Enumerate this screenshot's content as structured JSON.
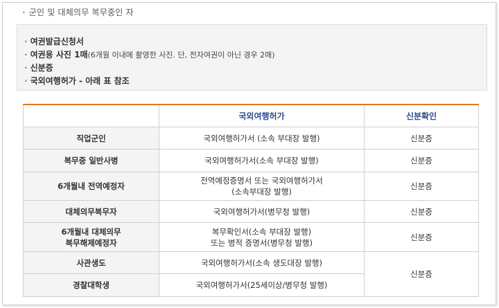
{
  "section_title": "군인 및 대체의무 복무중인 자",
  "documents": [
    {
      "label": "여권발급신청서",
      "note": ""
    },
    {
      "label": "여권용 사진 1매",
      "note": "(6개월 이내에 촬영한 사진. 단, 전자여권이 아닌 경우 2매)"
    },
    {
      "label": "신분증",
      "note": ""
    },
    {
      "label": "국외여행허가 - 아래 표 참조",
      "note": ""
    }
  ],
  "table": {
    "headers": [
      "",
      "국외여행허가",
      "신분확인"
    ],
    "rows": [
      {
        "category": [
          "직업군인"
        ],
        "permit": [
          "국외여행허가서 (소속 부대장 발행)"
        ],
        "id_check": "신분증"
      },
      {
        "category": [
          "복무중 일반사병"
        ],
        "permit": [
          "국외여행허가서(소속 부대장 발행)"
        ],
        "id_check": "신분증"
      },
      {
        "category": [
          "6개월내 전역예정자"
        ],
        "permit": [
          "전역예정증명서 또는 국외여행허가서",
          "(소속부대장 발행)"
        ],
        "id_check": "신분증"
      },
      {
        "category": [
          "대체의무복무자"
        ],
        "permit": [
          "국외여행허가서(병무청 발행)"
        ],
        "id_check": "신분증"
      },
      {
        "category": [
          "6개월내 대체의무",
          "복무해제예정자"
        ],
        "permit": [
          "복무확인서(소속 부대장 발행)",
          "또는 병적 증명서(병무청 발행)"
        ],
        "id_check": "신분증"
      },
      {
        "category": [
          "사관생도"
        ],
        "permit": [
          "국외여행허가서(소속 생도대장 발행)"
        ],
        "id_check": "신분증"
      },
      {
        "category": [
          "경찰대학생"
        ],
        "permit": [
          "국외여행허가서(25세이상/병무청 발행)"
        ],
        "id_check": null
      }
    ]
  },
  "colors": {
    "accent": "#e07b1a",
    "header_text": "#2a4d8f",
    "row_label_bg": "#f4f4f4",
    "box_bg": "#f4f4f4"
  }
}
